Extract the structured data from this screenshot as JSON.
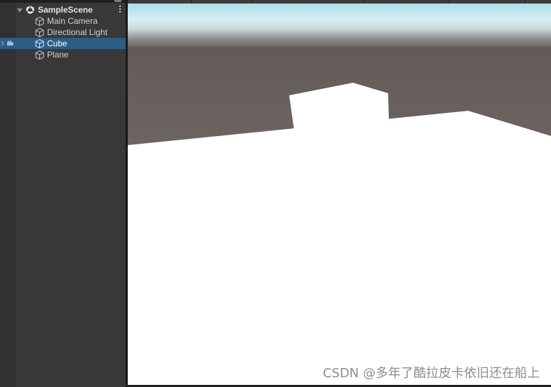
{
  "hierarchy": {
    "scene": {
      "name": "SampleScene",
      "icon": "unity-scene-icon",
      "menu_icon": "kebab-menu-icon"
    },
    "items": [
      {
        "label": "Main Camera",
        "icon": "gameobject-cube-icon",
        "selected": false
      },
      {
        "label": "Directional Light",
        "icon": "gameobject-cube-icon",
        "selected": false
      },
      {
        "label": "Cube",
        "icon": "gameobject-cube-icon",
        "selected": true
      },
      {
        "label": "Plane",
        "icon": "gameobject-cube-icon",
        "selected": false
      }
    ]
  },
  "game_view": {
    "watermark": "CSDN @多年了酷拉皮卡依旧还在船上",
    "colors": {
      "sky_top": "#b8dde8",
      "horizon": "#5e5a57",
      "ground": "#6a625e",
      "lit_surface": "#ffffff",
      "selection": "#2c5d87"
    }
  }
}
